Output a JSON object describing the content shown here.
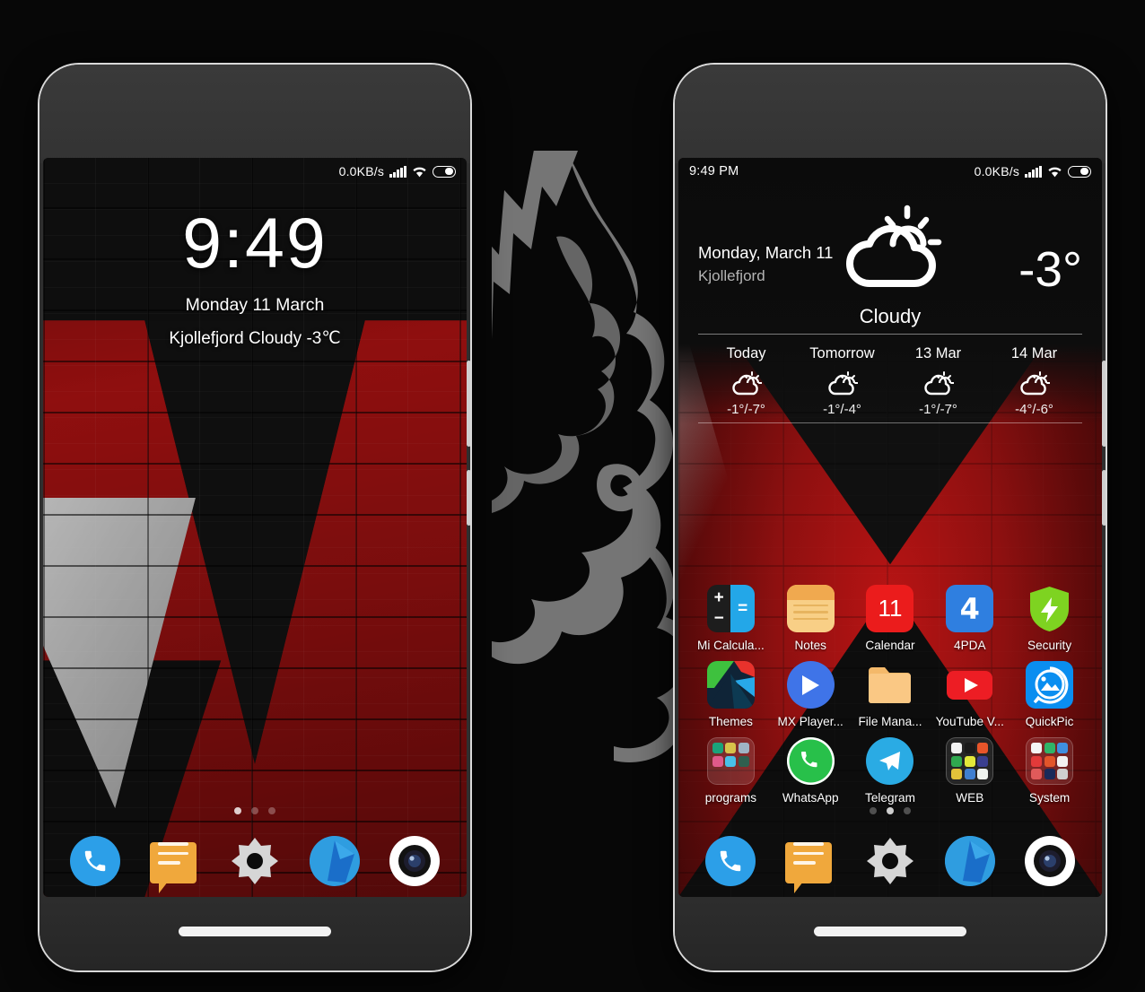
{
  "scene": {
    "background_color": "#070707",
    "wolf_logo": "tribal-wolf-head"
  },
  "left_phone": {
    "type": "lockscreen",
    "status_bar": {
      "net_speed": "0.0KB/s",
      "signal_icon": "signal-bars-icon",
      "wifi_icon": "wifi-icon",
      "battery_icon": "battery-icon"
    },
    "clock": "9:49",
    "date": "Monday 11 March",
    "weather_line": "Kjollefjord  Cloudy  -3℃",
    "page_dots": {
      "count": 3,
      "active": 0
    },
    "dock": [
      {
        "name": "phone",
        "icon": "phone-icon",
        "color": "#2c9fe8"
      },
      {
        "name": "messages",
        "icon": "message-icon",
        "color": "#f0a83c"
      },
      {
        "name": "settings",
        "icon": "gear-icon",
        "color": "#d8d8d8"
      },
      {
        "name": "mi-browser",
        "icon": "browser-icon",
        "color": "#2f9de0"
      },
      {
        "name": "camera",
        "icon": "camera-icon",
        "color": "#ffffff"
      }
    ]
  },
  "right_phone": {
    "type": "homescreen",
    "status_bar": {
      "time": "9:49 PM",
      "net_speed": "0.0KB/s",
      "signal_icon": "signal-bars-icon",
      "wifi_icon": "wifi-icon",
      "battery_icon": "battery-icon"
    },
    "weather": {
      "date": "Monday, March 11",
      "city": "Kjollefjord",
      "temperature": "-3°",
      "condition": "Cloudy",
      "condition_icon": "partly-cloudy-icon",
      "forecast": [
        {
          "day": "Today",
          "icon": "partly-cloudy-icon",
          "temps": "-1°/-7°"
        },
        {
          "day": "Tomorrow",
          "icon": "partly-cloudy-icon",
          "temps": "-1°/-4°"
        },
        {
          "day": "13 Mar",
          "icon": "partly-cloudy-icon",
          "temps": "-1°/-7°"
        },
        {
          "day": "14 Mar",
          "icon": "partly-cloudy-icon",
          "temps": "-4°/-6°"
        }
      ]
    },
    "apps": [
      [
        {
          "label": "Mi Calcula...",
          "icon": "calculator-icon"
        },
        {
          "label": "Notes",
          "icon": "notes-icon"
        },
        {
          "label": "Calendar",
          "icon": "calendar-icon",
          "badge": "11"
        },
        {
          "label": "4PDA",
          "icon": "4pda-icon",
          "glyph": "4"
        },
        {
          "label": "Security",
          "icon": "shield-icon"
        }
      ],
      [
        {
          "label": "Themes",
          "icon": "themes-icon"
        },
        {
          "label": "MX Player...",
          "icon": "play-icon"
        },
        {
          "label": "File Mana...",
          "icon": "folder-icon"
        },
        {
          "label": "YouTube V...",
          "icon": "youtube-icon"
        },
        {
          "label": "QuickPic",
          "icon": "gallery-icon"
        }
      ],
      [
        {
          "label": "programs",
          "icon": "app-folder-icon"
        },
        {
          "label": "WhatsApp",
          "icon": "whatsapp-icon"
        },
        {
          "label": "Telegram",
          "icon": "telegram-icon"
        },
        {
          "label": "WEB",
          "icon": "app-folder-icon"
        },
        {
          "label": "System",
          "icon": "app-folder-icon"
        }
      ]
    ],
    "page_dots": {
      "count": 3,
      "active": 1
    },
    "dock": [
      {
        "name": "phone",
        "icon": "phone-icon",
        "color": "#2c9fe8"
      },
      {
        "name": "messages",
        "icon": "message-icon",
        "color": "#f0a83c"
      },
      {
        "name": "settings",
        "icon": "gear-icon",
        "color": "#d8d8d8"
      },
      {
        "name": "mi-browser",
        "icon": "browser-icon",
        "color": "#2f9de0"
      },
      {
        "name": "camera",
        "icon": "camera-icon",
        "color": "#ffffff"
      }
    ]
  },
  "palette": {
    "accent_red": "#b81414",
    "dark": "#131313",
    "silver": "#e6e6e6"
  }
}
